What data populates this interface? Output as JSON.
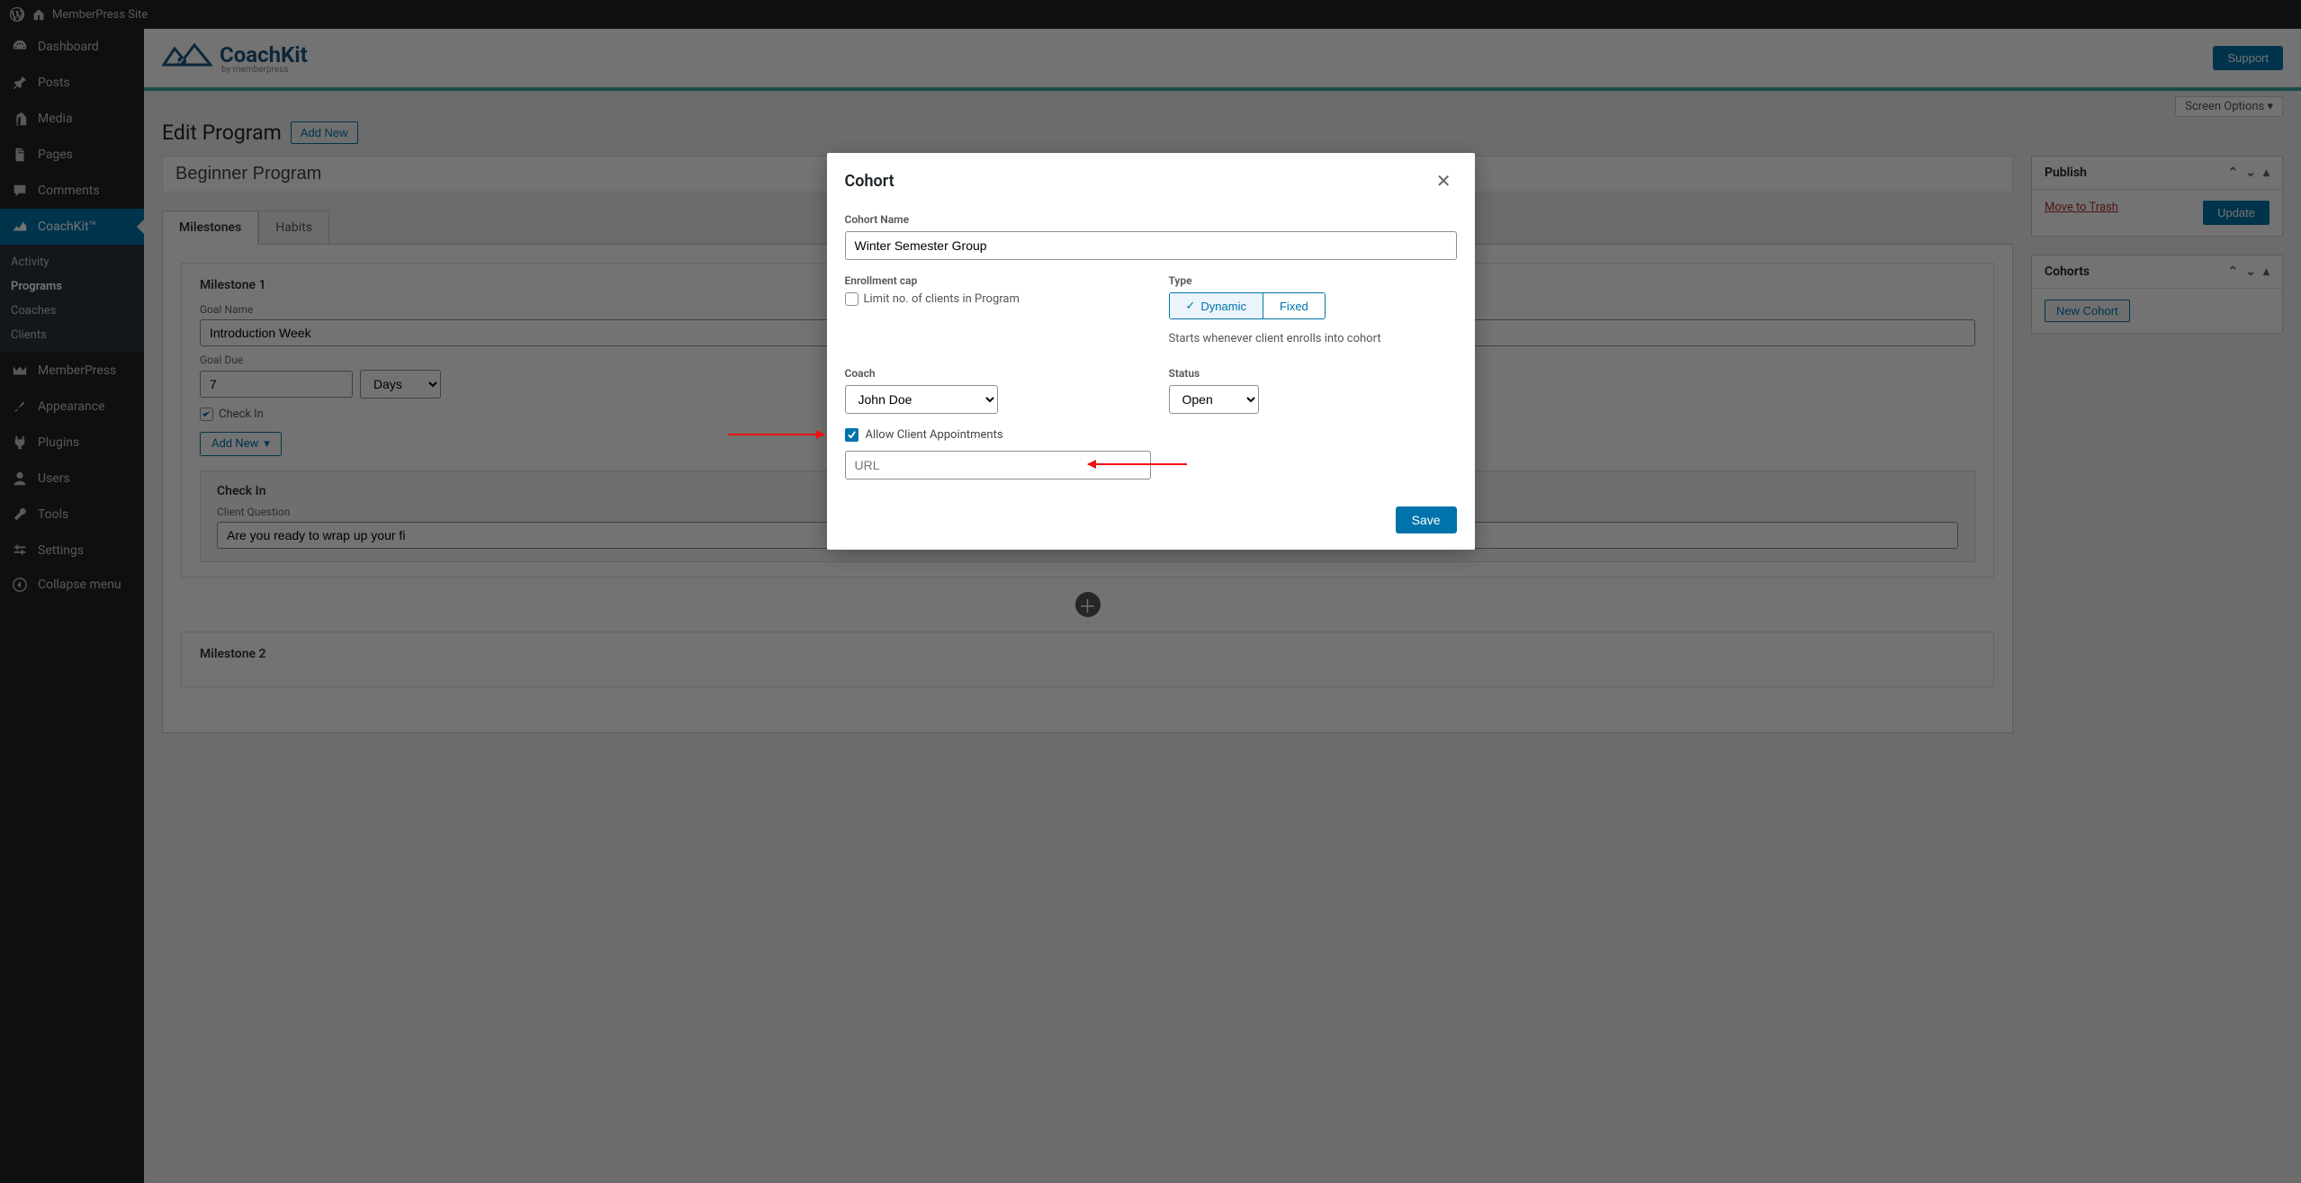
{
  "toolbar": {
    "site_name": "MemberPress Site"
  },
  "sidebar": {
    "items": [
      {
        "label": "Dashboard"
      },
      {
        "label": "Posts"
      },
      {
        "label": "Media"
      },
      {
        "label": "Pages"
      },
      {
        "label": "Comments"
      },
      {
        "label": "CoachKit™"
      },
      {
        "label": "MemberPress"
      },
      {
        "label": "Appearance"
      },
      {
        "label": "Plugins"
      },
      {
        "label": "Users"
      },
      {
        "label": "Tools"
      },
      {
        "label": "Settings"
      },
      {
        "label": "Collapse menu"
      }
    ],
    "coachkit_sub": [
      {
        "label": "Activity"
      },
      {
        "label": "Programs"
      },
      {
        "label": "Coaches"
      },
      {
        "label": "Clients"
      }
    ]
  },
  "banner": {
    "logo_main": "CoachKit",
    "logo_sub": "by memberpress",
    "support": "Support"
  },
  "screen_options": "Screen Options ▾",
  "page_head": {
    "title": "Edit Program",
    "add_new": "Add New"
  },
  "title_value": "Beginner Program",
  "tabs": {
    "milestones": "Milestones",
    "habits": "Habits"
  },
  "milestone1": {
    "head": "Milestone 1",
    "goal_name_label": "Goal Name",
    "goal_name_value": "Introduction Week",
    "goal_due_label": "Goal Due",
    "goal_due_value": "7",
    "goal_due_unit": "Days",
    "checkin_lbl": "Check In",
    "add_new": "Add New",
    "checkin_head": "Check In",
    "client_q_label": "Client Question",
    "client_q_value": "Are you ready to wrap up your fi"
  },
  "milestone2": {
    "head": "Milestone 2"
  },
  "publish": {
    "title": "Publish",
    "trash": "Move to Trash",
    "update": "Update"
  },
  "cohorts": {
    "title": "Cohorts",
    "new": "New Cohort"
  },
  "modal": {
    "title": "Cohort",
    "name_label": "Cohort Name",
    "name_value": "Winter Semester Group",
    "enroll_label": "Enrollment cap",
    "limit_label": "Limit no. of clients in Program",
    "type_label": "Type",
    "type_dynamic": "Dynamic",
    "type_fixed": "Fixed",
    "type_hint": "Starts whenever client enrolls into cohort",
    "coach_label": "Coach",
    "coach_value": "John Doe",
    "status_label": "Status",
    "status_value": "Open",
    "allow_label": "Allow Client Appointments",
    "url_placeholder": "URL",
    "save": "Save"
  }
}
